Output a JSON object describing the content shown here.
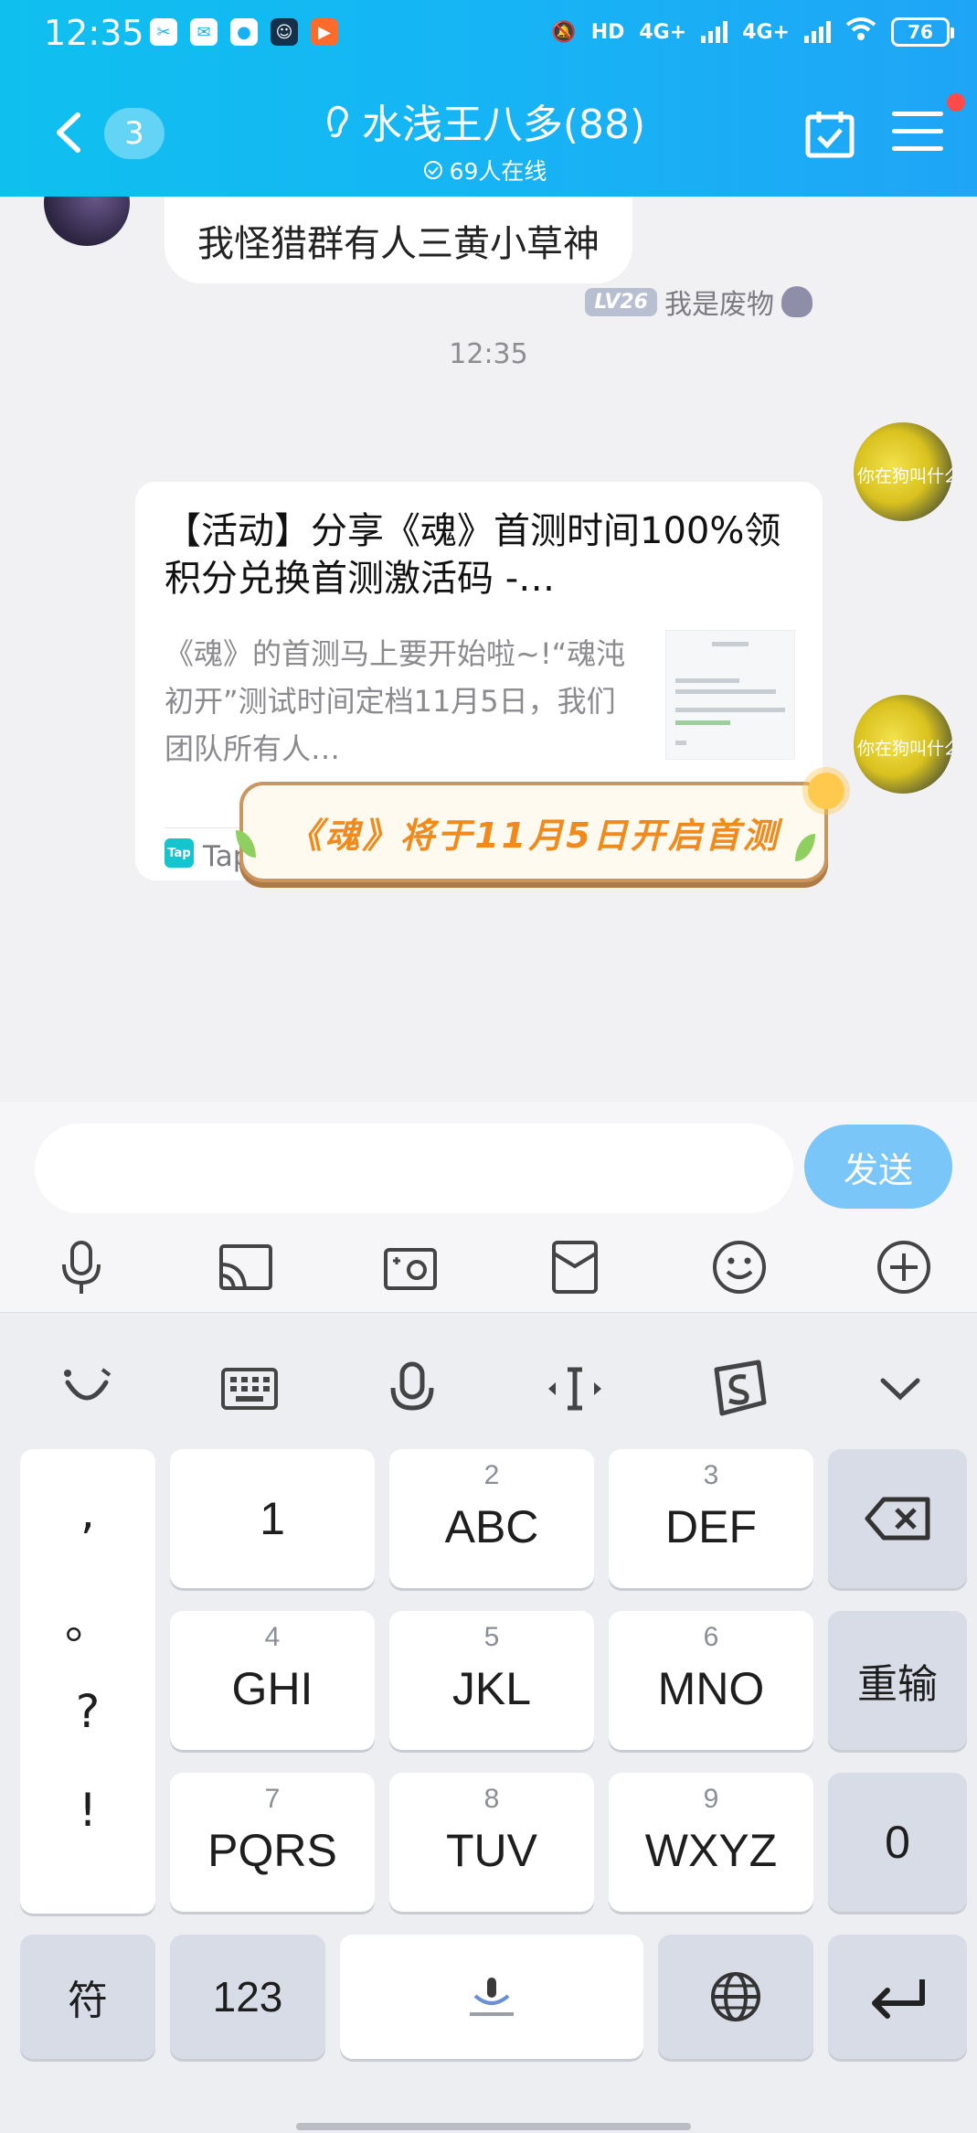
{
  "status_bar": {
    "time": "12:35",
    "network_1": "4G+",
    "network_2": "4G+",
    "hd": "HD",
    "battery": "76"
  },
  "header": {
    "back_count": "3",
    "title": "水浅王八多(88)",
    "online": "69人在线"
  },
  "chat": {
    "prev_message": "我怪猎群有人三黄小草神",
    "timestamp": "12:35",
    "sender_level": "LV26",
    "sender_name": "我是废物",
    "avatar_caption": "你在狗叫什么",
    "card": {
      "title": "【活动】分享《魂》首测时间100%领积分兑换首测激活码 -…",
      "description": "《魂》的首测马上要开始啦~!“魂沌初开”测试时间定档11月5日，我们团队所有人…",
      "source": "TapTap 发现好游戏",
      "logo": "Tap"
    },
    "sticker_text": "《魂》将于11月5日开启首测"
  },
  "input": {
    "placeholder": "",
    "send_label": "发送"
  },
  "keyboard": {
    "punct": [
      ",",
      "。",
      "?",
      "!"
    ],
    "keys": [
      {
        "num": "",
        "label": "1"
      },
      {
        "num": "2",
        "label": "ABC"
      },
      {
        "num": "3",
        "label": "DEF"
      },
      {
        "num": "4",
        "label": "GHI"
      },
      {
        "num": "5",
        "label": "JKL"
      },
      {
        "num": "6",
        "label": "MNO"
      },
      {
        "num": "7",
        "label": "PQRS"
      },
      {
        "num": "8",
        "label": "TUV"
      },
      {
        "num": "9",
        "label": "WXYZ"
      }
    ],
    "reenter": "重输",
    "zero": "0",
    "symbol": "符",
    "num123": "123"
  },
  "colors": {
    "header": "#17b3f5",
    "send": "#7bc6f8",
    "sticker_text": "#f08a1d"
  }
}
